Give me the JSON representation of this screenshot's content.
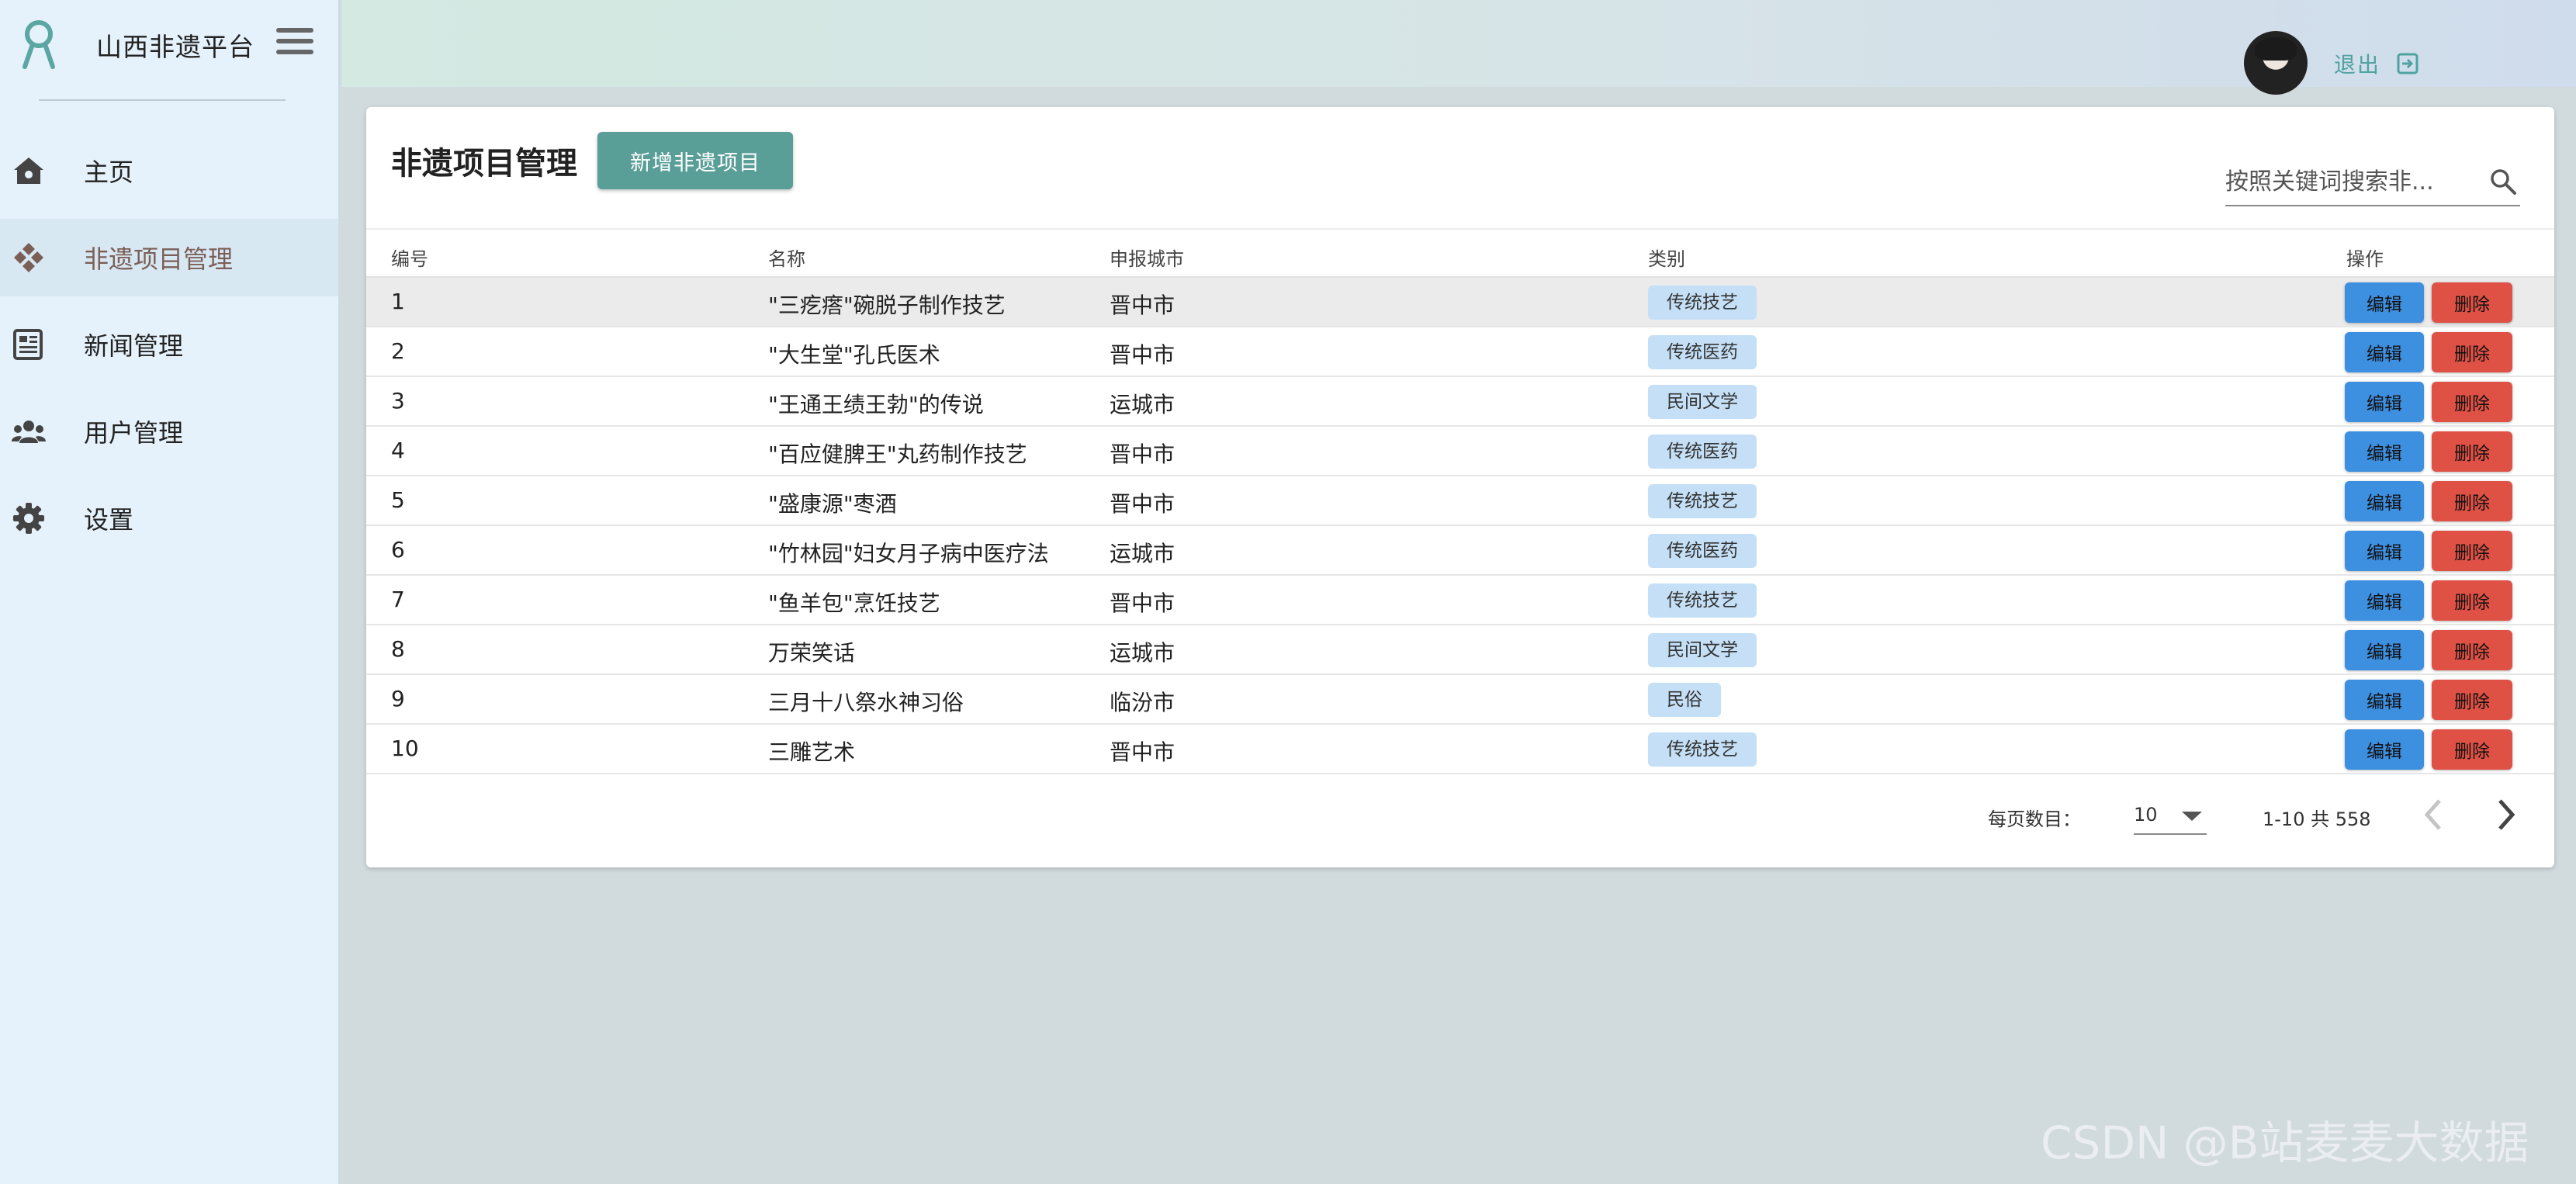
{
  "sidebar": {
    "title": "山西非遗平台",
    "items": [
      {
        "label": "主页",
        "icon": "home-icon"
      },
      {
        "label": "非遗项目管理",
        "icon": "diamond-icon"
      },
      {
        "label": "新闻管理",
        "icon": "newspaper-icon"
      },
      {
        "label": "用户管理",
        "icon": "people-icon"
      },
      {
        "label": "设置",
        "icon": "gear-icon"
      }
    ],
    "active_index": 1
  },
  "topbar": {
    "logout_label": "退出"
  },
  "main": {
    "title": "非遗项目管理",
    "add_button": "新增非遗项目",
    "search_placeholder": "按照关键词搜索非..."
  },
  "table": {
    "headers": {
      "id": "编号",
      "name": "名称",
      "city": "申报城市",
      "category": "类别",
      "actions": "操作"
    },
    "edit_label": "编辑",
    "delete_label": "删除",
    "rows": [
      {
        "id": "1",
        "name": "\"三疙瘩\"碗脱子制作技艺",
        "city": "晋中市",
        "category": "传统技艺"
      },
      {
        "id": "2",
        "name": "\"大生堂\"孔氏医术",
        "city": "晋中市",
        "category": "传统医药"
      },
      {
        "id": "3",
        "name": "\"王通王绩王勃\"的传说",
        "city": "运城市",
        "category": "民间文学"
      },
      {
        "id": "4",
        "name": "\"百应健脾王\"丸药制作技艺",
        "city": "晋中市",
        "category": "传统医药"
      },
      {
        "id": "5",
        "name": "\"盛康源\"枣酒",
        "city": "晋中市",
        "category": "传统技艺"
      },
      {
        "id": "6",
        "name": "\"竹林园\"妇女月子病中医疗法",
        "city": "运城市",
        "category": "传统医药"
      },
      {
        "id": "7",
        "name": "\"鱼羊包\"烹饪技艺",
        "city": "晋中市",
        "category": "传统技艺"
      },
      {
        "id": "8",
        "name": "万荣笑话",
        "city": "运城市",
        "category": "民间文学"
      },
      {
        "id": "9",
        "name": "三月十八祭水神习俗",
        "city": "临汾市",
        "category": "民俗"
      },
      {
        "id": "10",
        "name": "三雕艺术",
        "city": "晋中市",
        "category": "传统技艺"
      }
    ]
  },
  "pagination": {
    "per_page_label": "每页数目：",
    "per_page_value": "10",
    "range_text": "1-10 共 558"
  },
  "watermark": "CSDN @B站麦麦大数据",
  "colors": {
    "accent": "#5a9e98",
    "edit": "#3d8fe0",
    "delete": "#e05145",
    "chip": "#c5e0f6",
    "sidebar_bg": "#e6f2fb"
  }
}
